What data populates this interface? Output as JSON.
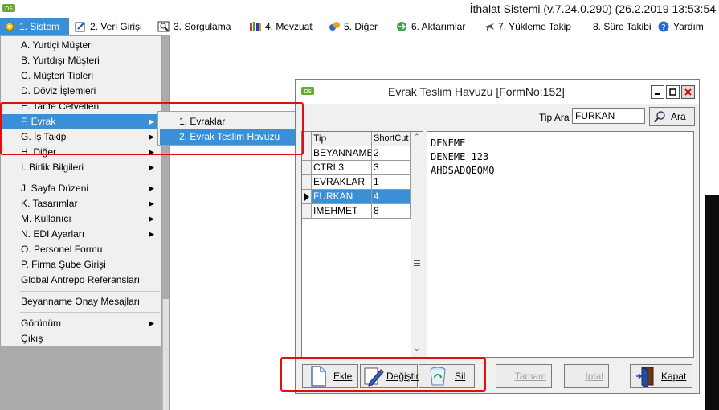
{
  "app": {
    "title": "İthalat Sistemi (v.7.24.0.290) (26.2.2019 13:53:54"
  },
  "menubar": [
    {
      "label": "1.  Sistem",
      "icon": "gear-icon",
      "active": true
    },
    {
      "label": "2.  Veri Girişi",
      "icon": "data-entry-icon"
    },
    {
      "label": "3.  Sorgulama",
      "icon": "query-icon"
    },
    {
      "label": "4.  Mevzuat",
      "icon": "books-icon"
    },
    {
      "label": "5.  Diğer",
      "icon": "other-icon"
    },
    {
      "label": "6.  Aktarımlar",
      "icon": "transfer-icon"
    },
    {
      "label": "7.  Yükleme Takip",
      "icon": "plane-icon"
    },
    {
      "label": "8. Süre Takibi",
      "icon": ""
    },
    {
      "label": "Yardım",
      "icon": "help-icon"
    }
  ],
  "main_menu": {
    "items": [
      {
        "label": "A.  Yurtiçi Müşteri"
      },
      {
        "label": "B.  Yurtdışı Müşteri"
      },
      {
        "label": "C.  Müşteri Tipleri"
      },
      {
        "label": "D.  Döviz İşlemleri"
      },
      {
        "label": "E.  Tarife Cetvelleri"
      },
      {
        "label": "F.  Evrak",
        "submenu": true,
        "selected": true
      },
      {
        "label": "G.  İş Takip",
        "submenu": true
      },
      {
        "label": "H.  Diğer",
        "submenu": true
      },
      {
        "label": "I.  Birlik Bilgileri",
        "submenu": true
      },
      {
        "label": "J.  Sayfa Düzeni",
        "submenu": true
      },
      {
        "label": "K.  Tasarımlar",
        "submenu": true
      },
      {
        "label": "M.  Kullanıcı",
        "submenu": true
      },
      {
        "label": "N.  EDI Ayarları",
        "submenu": true
      },
      {
        "label": "O.  Personel Formu"
      },
      {
        "label": "P.  Firma Şube Girişi"
      },
      {
        "label": "Global Antrepo Referansları"
      },
      {
        "label": "Beyanname Onay Mesajları"
      },
      {
        "label": "Görünüm",
        "submenu": true
      },
      {
        "label": "Çıkış"
      }
    ],
    "submenu_arrow": "▶"
  },
  "sub_menu": {
    "items": [
      {
        "label": "1.   Evraklar"
      },
      {
        "label": "2.   Evrak Teslim Havuzu",
        "selected": true
      }
    ]
  },
  "window": {
    "title": "Evrak Teslim Havuzu [FormNo:152]",
    "tip_ara_label": "Tip Ara",
    "tip_ara_value": "FURKAN",
    "ara_button": "Ara",
    "grid": {
      "columns": [
        "Tip",
        "ShortCut"
      ],
      "rows": [
        [
          "BEYANNAME",
          "2"
        ],
        [
          "CTRL3",
          "3"
        ],
        [
          "EVRAKLAR",
          "1"
        ],
        [
          "FURKAN",
          "4"
        ],
        [
          "IMEHMET",
          "8"
        ]
      ],
      "selected_row": 3
    },
    "memo_lines": [
      "DENEME",
      "DENEME 123",
      "AHDSADQEQMQ"
    ],
    "buttons": {
      "ekle": "Ekle",
      "degistir": "Değiştir",
      "sil": "Sil",
      "tamam": "Tamam",
      "iptal": "İptal",
      "kapat": "Kapat"
    }
  },
  "colors": {
    "selection": "#3b8fd6",
    "highlight_box": "#e01010"
  }
}
